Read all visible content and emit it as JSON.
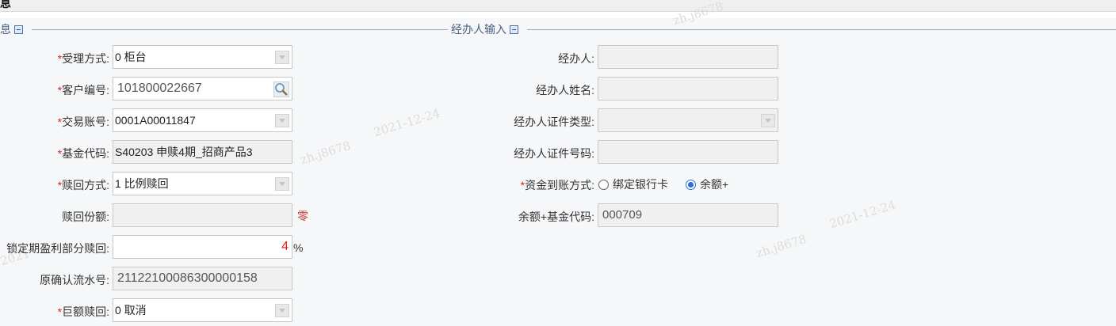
{
  "header": {
    "title_fragment": "息"
  },
  "sections": {
    "left_title": "息",
    "right_title": "经办人输入"
  },
  "form": {
    "accept_method": {
      "label": "受理方式:",
      "value": "0 柜台"
    },
    "customer_no": {
      "label": "客户编号:",
      "value": "101800022667"
    },
    "trade_account": {
      "label": "交易账号:",
      "value": "0001A00011847"
    },
    "fund_code": {
      "label": "基金代码:",
      "value": "S40203 申赎4期_招商产品3"
    },
    "redeem_method": {
      "label": "赎回方式:",
      "value": "1 比例赎回"
    },
    "redeem_shares": {
      "label": "赎回份额:",
      "value": "",
      "note": "零"
    },
    "lock_profit": {
      "label": "锁定期盈利部分赎回:",
      "value": "4",
      "unit": "%"
    },
    "orig_serial": {
      "label": "原确认流水号:",
      "value": "21122100086300000158"
    },
    "large_redeem": {
      "label": "巨额赎回:",
      "value": "0 取消"
    }
  },
  "agent": {
    "agent": {
      "label": "经办人:",
      "value": ""
    },
    "agent_name": {
      "label": "经办人姓名:",
      "value": ""
    },
    "id_type": {
      "label": "经办人证件类型:",
      "value": ""
    },
    "id_no": {
      "label": "经办人证件号码:",
      "value": ""
    },
    "arrival": {
      "label": "资金到账方式:",
      "options": [
        "绑定银行卡",
        "余额+"
      ],
      "selected": "余额+"
    },
    "balance_fund_code": {
      "label": "余额+基金代码:",
      "value": "000709"
    }
  },
  "required_mark": "*",
  "watermarks": [
    "zh.j8678",
    "2021-12-24",
    "zh.j8678",
    "2021-12-24",
    "zh.j8678",
    "2021-12-24",
    "2021"
  ],
  "colors": {
    "required": "#e02020",
    "accent": "#2a6ed6",
    "section_title": "#4a5f82"
  }
}
